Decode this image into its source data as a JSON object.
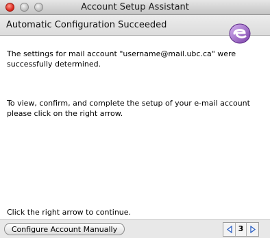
{
  "window": {
    "title": "Account Setup Assistant"
  },
  "header": {
    "title": "Automatic Configuration Succeeded"
  },
  "main": {
    "paragraph1": "The settings for mail account \"username@mail.ubc.ca\" were successfully determined.",
    "paragraph2": "To view, confirm, and complete the setup of your e-mail account please click on the right arrow.",
    "instruction": "Click the right arrow to continue."
  },
  "footer": {
    "configure_button": "Configure Account Manually",
    "page": "3"
  },
  "icons": {
    "logo": "entourage-logo-icon",
    "prev": "left-arrow-icon",
    "next": "right-arrow-icon"
  },
  "colors": {
    "logo": "#7a3ea8",
    "arrow": "#2b5fc3"
  }
}
